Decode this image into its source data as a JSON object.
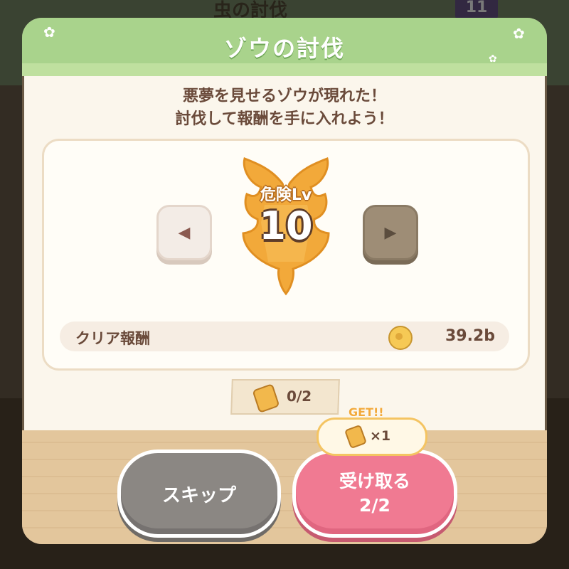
{
  "background": {
    "title": "虫の討伐",
    "badge": "11"
  },
  "modal": {
    "title": "ゾウの討伐",
    "description_line1": "悪夢を見せるゾウが現れた！",
    "description_line2": "討伐して報酬を手に入れよう！"
  },
  "danger": {
    "label": "危険Lv",
    "level": "10"
  },
  "reward": {
    "label": "クリア報酬",
    "value": "39.2b",
    "icon": "coin-icon"
  },
  "tickets": {
    "count": "0/2",
    "icon": "ticket-icon"
  },
  "get_bubble": {
    "label": "GET!!",
    "count": "×1"
  },
  "buttons": {
    "skip": "スキップ",
    "receive_line1": "受け取る",
    "receive_line2": "2/2"
  },
  "colors": {
    "header": "#a9d38c",
    "badge": "#f2a93a",
    "receive_button": "#f07a92",
    "skip_button": "#8b8783"
  }
}
